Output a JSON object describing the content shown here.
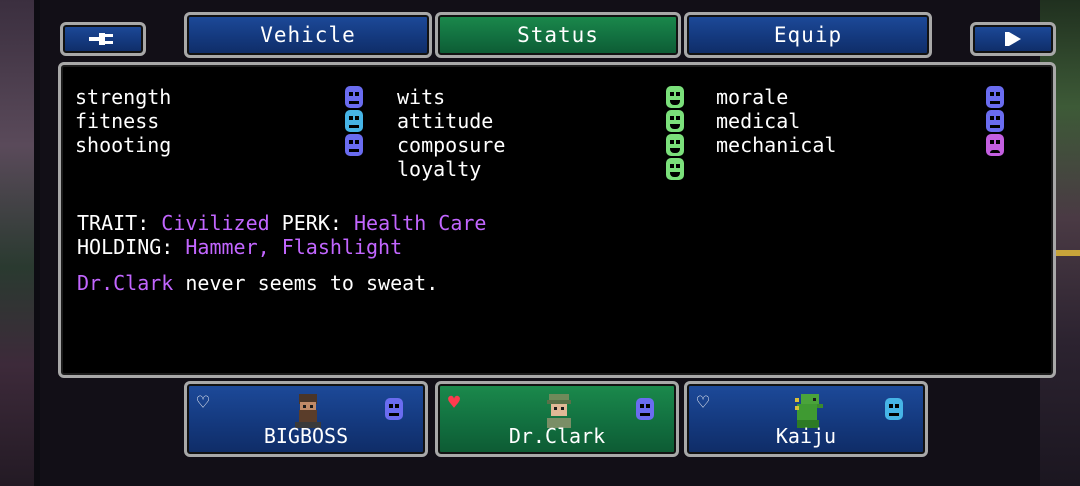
{
  "tabs": [
    {
      "label": "Vehicle",
      "active": false
    },
    {
      "label": "Status",
      "active": true
    },
    {
      "label": "Equip",
      "active": false
    }
  ],
  "nav": {
    "back_icon": "plug-icon",
    "next_icon": "play-icon"
  },
  "stats": {
    "col1": [
      {
        "label": "strength",
        "mood": "neutral",
        "color": "#6a6cf0"
      },
      {
        "label": "fitness",
        "mood": "neutral",
        "color": "#46b4e6"
      },
      {
        "label": "shooting",
        "mood": "neutral",
        "color": "#6a6cf0"
      }
    ],
    "col2": [
      {
        "label": "wits",
        "mood": "happy",
        "color": "#7be07b"
      },
      {
        "label": "attitude",
        "mood": "happy",
        "color": "#7be07b"
      },
      {
        "label": "composure",
        "mood": "happy",
        "color": "#7be07b"
      },
      {
        "label": "loyalty",
        "mood": "happy",
        "color": "#7be07b"
      }
    ],
    "col3": [
      {
        "label": "morale",
        "mood": "neutral",
        "color": "#6a6cf0"
      },
      {
        "label": "medical",
        "mood": "neutral",
        "color": "#6a6cf0"
      },
      {
        "label": "mechanical",
        "mood": "sad",
        "color": "#c35fe0"
      }
    ]
  },
  "info": {
    "trait_label": "TRAIT:",
    "trait_value": "Civilized",
    "perk_label": "PERK:",
    "perk_value": "Health Care",
    "holding_label": "HOLDING:",
    "holding_value": "Hammer, Flashlight",
    "flavor_name": "Dr.Clark",
    "flavor_text": " never seems to sweat."
  },
  "characters": [
    {
      "name": "BIGBOSS",
      "heart": "empty",
      "selected": false,
      "portrait": "bearded-man-icon"
    },
    {
      "name": "Dr.Clark",
      "heart": "full",
      "selected": true,
      "portrait": "doctor-cap-icon"
    },
    {
      "name": "Kaiju",
      "heart": "empty",
      "selected": false,
      "portrait": "dinosaur-icon"
    }
  ],
  "colors": {
    "accent_purple": "#c266ff",
    "tab_blue": "#14397e",
    "tab_green": "#127040",
    "heart_red": "#ff3b4e"
  }
}
